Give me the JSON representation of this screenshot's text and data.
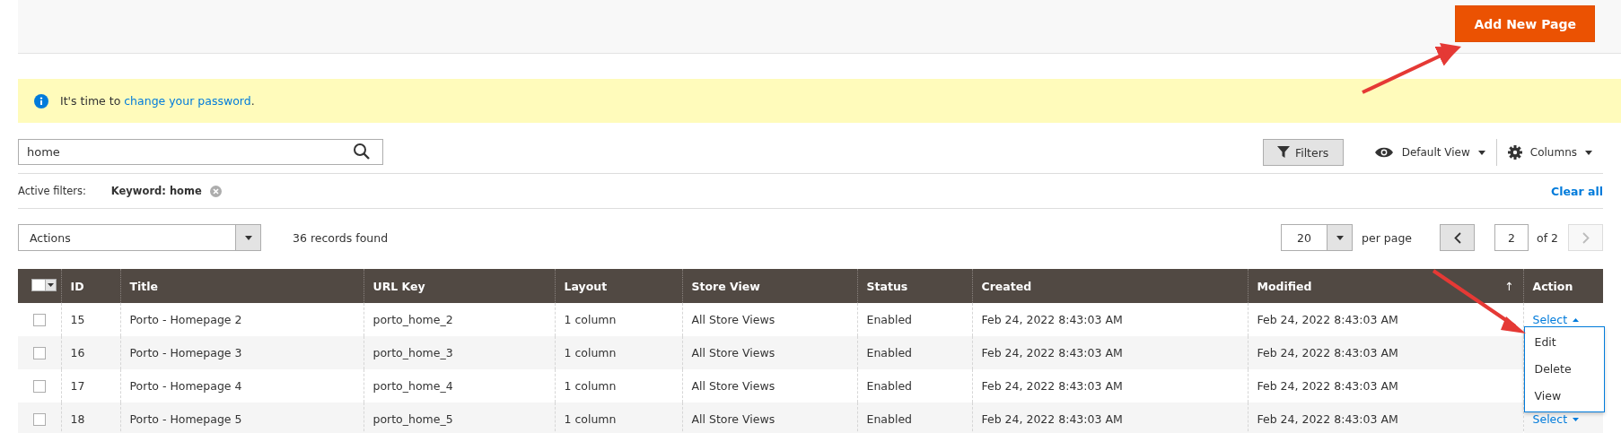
{
  "header": {
    "add_button": "Add New Page"
  },
  "notice": {
    "text": "It's time to ",
    "link": "change your password",
    "suffix": "."
  },
  "search": {
    "value": "home"
  },
  "toolbar": {
    "filters": "Filters",
    "view": "Default View",
    "columns": "Columns"
  },
  "active_filters": {
    "label": "Active filters:",
    "chips": [
      "Keyword: home"
    ],
    "clear": "Clear all"
  },
  "actions": {
    "select": "Actions",
    "records": "36 records found",
    "per_page_value": "20",
    "per_page_label": "per page",
    "page": "2",
    "of": "of 2"
  },
  "table": {
    "columns": [
      {
        "label": "ID"
      },
      {
        "label": "Title"
      },
      {
        "label": "URL Key"
      },
      {
        "label": "Layout"
      },
      {
        "label": "Store View"
      },
      {
        "label": "Status"
      },
      {
        "label": "Created"
      },
      {
        "label": "Modified",
        "sort": "↑"
      },
      {
        "label": "Action"
      }
    ],
    "rows": [
      {
        "checked": false,
        "cells": [
          "15",
          "Porto - Homepage 2",
          "porto_home_2",
          "1 column",
          "All Store Views",
          "Enabled",
          "Feb 24, 2022 8:43:03 AM",
          "Feb 24, 2022 8:43:03 AM"
        ],
        "action": "Select",
        "expanded": true,
        "menu": [
          "Edit",
          "Delete",
          "View"
        ]
      },
      {
        "checked": false,
        "cells": [
          "16",
          "Porto - Homepage 3",
          "porto_home_3",
          "1 column",
          "All Store Views",
          "Enabled",
          "Feb 24, 2022 8:43:03 AM",
          "Feb 24, 2022 8:43:03 AM"
        ]
      },
      {
        "checked": false,
        "cells": [
          "17",
          "Porto - Homepage 4",
          "porto_home_4",
          "1 column",
          "All Store Views",
          "Enabled",
          "Feb 24, 2022 8:43:03 AM",
          "Feb 24, 2022 8:43:03 AM"
        ]
      },
      {
        "checked": false,
        "cells": [
          "18",
          "Porto - Homepage 5",
          "porto_home_5",
          "1 column",
          "All Store Views",
          "Enabled",
          "Feb 24, 2022 8:43:03 AM",
          "Feb 24, 2022 8:43:03 AM"
        ],
        "action": "Select",
        "expanded": false
      }
    ]
  }
}
